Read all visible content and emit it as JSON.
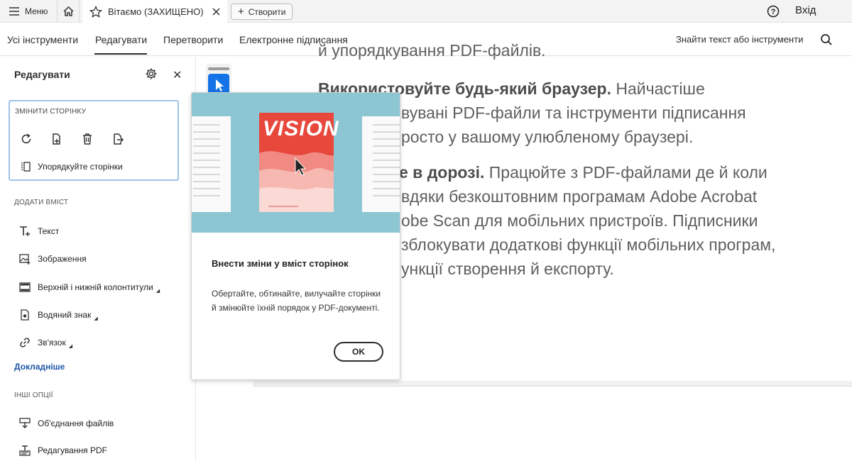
{
  "topbar": {
    "menu_label": "Меню",
    "tab_title": "Вітаємо (ЗАХИЩЕНО)",
    "create_label": "Створити",
    "signin_label": "Вхід"
  },
  "toolnav": {
    "tabs": [
      "Усі інструменти",
      "Редагувати",
      "Перетворити",
      "Електронне підписання"
    ],
    "active_tab": "Редагувати",
    "find_label": "Знайти текст або інструменти"
  },
  "panel": {
    "title": "Редагувати",
    "card_title": "ЗМІНИТИ СТОРІНКУ",
    "organize_label": "Упорядкуйте сторінки",
    "add_content_label": "ДОДАТИ ВМІСТ",
    "items": [
      "Текст",
      "Зображення",
      "Верхній і нижній колонтитули",
      "Водяний знак",
      "Зв'язок"
    ],
    "more_link": "Докладніше",
    "other_label": "ІНШІ ОПЦІЇ",
    "other_items": [
      "Об'єднання файлів",
      "Редагування PDF"
    ]
  },
  "document": {
    "line0": "й упорядкування PDF-файлів.",
    "p1_bold": "Використовуйте будь-який браузер.",
    "p1_rest": " Найчастіше",
    "p1_line2": "вувані PDF-файли та інструменти підписання",
    "p1_line3": "росто у вашому улюбленому браузері.",
    "p2_bold": "е в дорозі.",
    "p2_rest": " Працюйте з PDF-файлами де й коли",
    "p2_line2": "вдяки безкоштовним програмам Adobe Acrobat",
    "p2_line3": "obe Scan для мобільних пристроїв. Підписники",
    "p2_line4": "зблокувати додаткові функції мобільних програм,",
    "p2_line5": "ункції створення й експорту."
  },
  "popup": {
    "hero_word": "VISION",
    "title": "Внести зміни у вміст сторінок",
    "body": "Обертайте, обтинайте, вилучайте сторінки й змінюйте їхній порядок у PDF-документі.",
    "ok_label": "OK"
  },
  "colors": {
    "accent": "#1473e6",
    "link": "#1f56a8",
    "card_border": "#9fc2e8",
    "hero_bg": "#8cc6d3",
    "hero_red": "#e8473c"
  }
}
